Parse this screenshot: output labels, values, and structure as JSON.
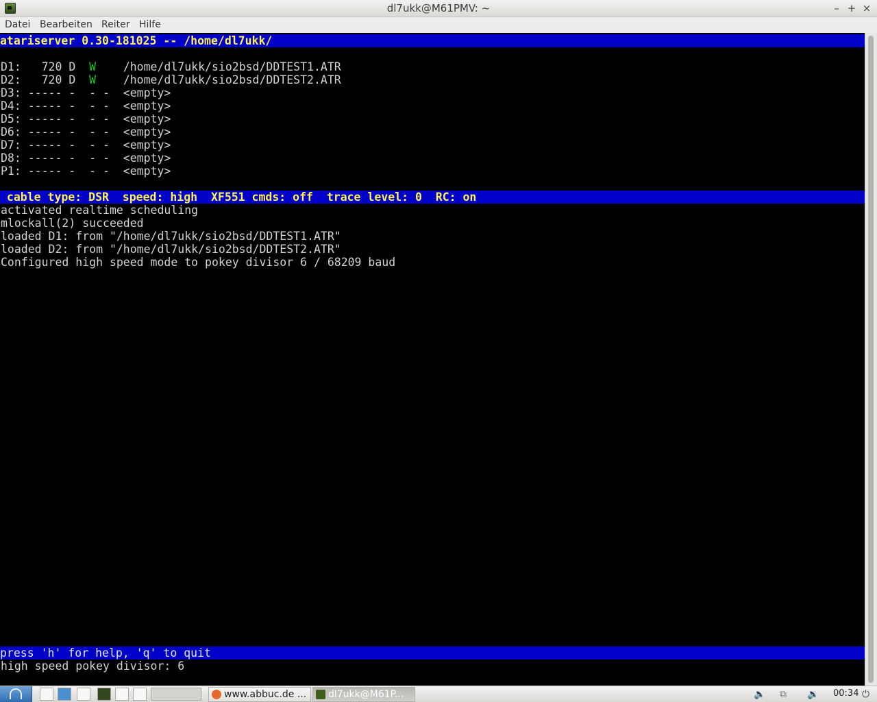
{
  "window": {
    "title": "dl7ukk@M61PMV: ~",
    "controls": {
      "minimize": "–",
      "maximize": "+",
      "close": "×"
    }
  },
  "menubar": [
    "Datei",
    "Bearbeiten",
    "Reiter",
    "Hilfe"
  ],
  "terminal": {
    "header": "atariserver 0.30-181025 -- /home/dl7ukk/",
    "drives": [
      {
        "pre": "D1:   720 D  ",
        "flag": "W",
        "post": "    /home/dl7ukk/sio2bsd/DDTEST1.ATR"
      },
      {
        "pre": "D2:   720 D  ",
        "flag": "W",
        "post": "    /home/dl7ukk/sio2bsd/DDTEST2.ATR"
      },
      {
        "pre": "D3: ----- -  - -  <empty>",
        "flag": "",
        "post": ""
      },
      {
        "pre": "D4: ----- -  - -  <empty>",
        "flag": "",
        "post": ""
      },
      {
        "pre": "D5: ----- -  - -  <empty>",
        "flag": "",
        "post": ""
      },
      {
        "pre": "D6: ----- -  - -  <empty>",
        "flag": "",
        "post": ""
      },
      {
        "pre": "D7: ----- -  - -  <empty>",
        "flag": "",
        "post": ""
      },
      {
        "pre": "D8: ----- -  - -  <empty>",
        "flag": "",
        "post": ""
      },
      {
        "pre": "P1: ----- -  - -  <empty>",
        "flag": "",
        "post": ""
      }
    ],
    "status": " cable type: DSR  speed: high  XF551 cmds: off  trace level: 0  RC: on",
    "log": [
      "activated realtime scheduling",
      "mlockall(2) succeeded",
      "loaded D1: from \"/home/dl7ukk/sio2bsd/DDTEST1.ATR\"",
      "loaded D2: from \"/home/dl7ukk/sio2bsd/DDTEST2.ATR\"",
      "Configured high speed mode to pokey divisor 6 / 68209 baud"
    ],
    "help": "press 'h' for help, 'q' to quit",
    "prompt": "high speed pokey divisor: 6"
  },
  "taskbar": {
    "tasks": [
      {
        "label": "www.abbuc.de ...",
        "icon": "firefox-icon",
        "color": "#e8672a"
      },
      {
        "label": "dl7ukk@M61P...",
        "icon": "terminal-icon",
        "color": "#3d5e1c"
      }
    ],
    "clock": "00:34"
  }
}
